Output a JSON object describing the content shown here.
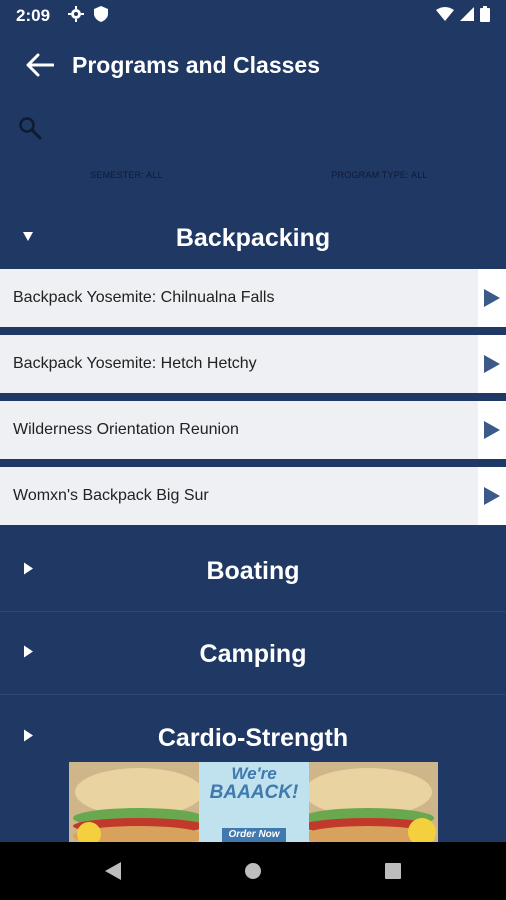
{
  "status_bar": {
    "time": "2:09",
    "left_icons": [
      "gear-icon",
      "shield-icon"
    ],
    "right_icons": [
      "wifi-icon",
      "signal-icon",
      "battery-icon"
    ]
  },
  "header": {
    "title": "Programs and Classes",
    "back_icon": "back-arrow-icon"
  },
  "search": {
    "icon": "search-icon"
  },
  "filters": {
    "semester_label": "SEMESTER: ALL",
    "program_type_label": "PROGRAM TYPE: ALL"
  },
  "sections": [
    {
      "title": "Backpacking",
      "expanded": true,
      "items": [
        {
          "label": "Backpack Yosemite: Chilnualna Falls"
        },
        {
          "label": "Backpack Yosemite: Hetch Hetchy"
        },
        {
          "label": "Wilderness Orientation Reunion"
        },
        {
          "label": "Womxn's Backpack Big Sur"
        }
      ]
    },
    {
      "title": "Boating",
      "expanded": false
    },
    {
      "title": "Camping",
      "expanded": false
    },
    {
      "title": "Cardio-Strength",
      "expanded": false
    }
  ],
  "ad": {
    "headline_line1": "We're",
    "headline_line2": "BAAACK!",
    "cta": "Order Now"
  },
  "colors": {
    "background": "#1f3864",
    "list_item_bg": "#eef0f3",
    "arrow": "#3b5a8a"
  }
}
